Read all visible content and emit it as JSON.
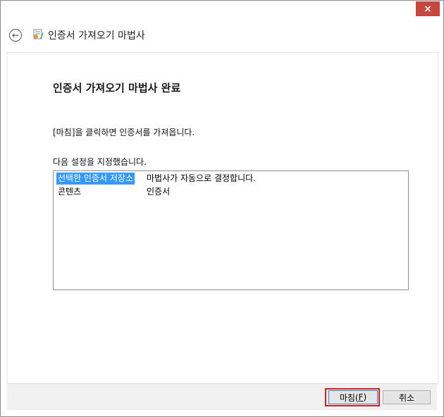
{
  "window": {
    "close_label": "×"
  },
  "header": {
    "back_glyph": "←",
    "title": "인증서 가져오기 마법사"
  },
  "main": {
    "heading": "인증서 가져오기 마법사 완료",
    "instruction": "[마침]을 클릭하면 인증서를 가져옵니다.",
    "settings_label": "다음 설정을 지정했습니다.",
    "settings": [
      {
        "key": "선택한 인증서 저장소",
        "value": "마법사가 자동으로 결정합니다.",
        "selected": true
      },
      {
        "key": "콘텐츠",
        "value": "인증서",
        "selected": false
      }
    ]
  },
  "footer": {
    "finish_prefix": "마침(",
    "finish_mnemonic": "F",
    "finish_suffix": ")",
    "cancel_label": "취소"
  },
  "colors": {
    "close": "#c7463d",
    "selection": "#3399ff",
    "highlight_outline": "#d0202c",
    "footer": "#f0f0f0"
  }
}
